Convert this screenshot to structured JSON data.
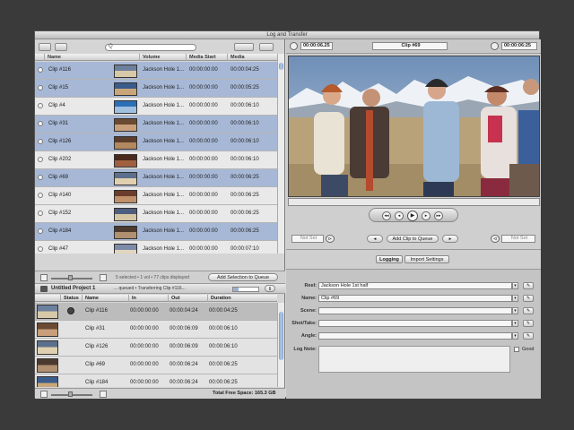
{
  "window": {
    "title": "Log and Transfer"
  },
  "browser": {
    "search_placeholder": "Q",
    "columns": [
      "Name",
      "Volume",
      "Media Start",
      "Media"
    ],
    "clips": [
      {
        "name": "Clip #116",
        "volume": "Jackson Hole 1...",
        "start": "00:00:00:00",
        "dur": "00:00:04:25",
        "selected": true
      },
      {
        "name": "Clip #15",
        "volume": "Jackson Hole 1...",
        "start": "00:00:00:00",
        "dur": "00:00:05:25",
        "selected": true
      },
      {
        "name": "Clip #4",
        "volume": "Jackson Hole 1...",
        "start": "00:00:00:00",
        "dur": "00:00:06:10",
        "selected": false
      },
      {
        "name": "Clip #31",
        "volume": "Jackson Hole 1...",
        "start": "00:00:00:00",
        "dur": "00:00:06:10",
        "selected": true
      },
      {
        "name": "Clip #126",
        "volume": "Jackson Hole 1...",
        "start": "00:00:00:00",
        "dur": "00:00:06:10",
        "selected": true
      },
      {
        "name": "Clip #202",
        "volume": "Jackson Hole 1...",
        "start": "00:00:00:00",
        "dur": "00:00:06:10",
        "selected": false
      },
      {
        "name": "Clip #69",
        "volume": "Jackson Hole 1...",
        "start": "00:00:00:00",
        "dur": "00:00:06:25",
        "selected": true
      },
      {
        "name": "Clip #140",
        "volume": "Jackson Hole 1...",
        "start": "00:00:00:00",
        "dur": "00:00:06:25",
        "selected": false
      },
      {
        "name": "Clip #152",
        "volume": "Jackson Hole 1...",
        "start": "00:00:00:00",
        "dur": "00:00:06:25",
        "selected": false
      },
      {
        "name": "Clip #184",
        "volume": "Jackson Hole 1...",
        "start": "00:00:00:00",
        "dur": "00:00:06:25",
        "selected": true
      },
      {
        "name": "Clip #47",
        "volume": "Jackson Hole 1...",
        "start": "00:00:00:00",
        "dur": "00:00:07:10",
        "selected": false
      }
    ],
    "status_text": "5 selected • 1 vol • 77 clips displayed",
    "add_selection_label": "Add Selection to Queue"
  },
  "queue": {
    "project_name": "Untitled Project 1",
    "progress_text": "... queued • Transferring Clip #116...",
    "columns": [
      "Status",
      "Name",
      "In",
      "Out",
      "Duration"
    ],
    "items": [
      {
        "name": "Clip #116",
        "in": "00:00:00:00",
        "out": "00:00:04:24",
        "dur": "00:00:04:25",
        "active": true
      },
      {
        "name": "Clip #31",
        "in": "00:00:00:00",
        "out": "00:00:06:09",
        "dur": "00:00:06:10",
        "active": false
      },
      {
        "name": "Clip #126",
        "in": "00:00:00:00",
        "out": "00:00:06:09",
        "dur": "00:00:06:10",
        "active": false
      },
      {
        "name": "Clip #69",
        "in": "00:00:00:00",
        "out": "00:00:06:24",
        "dur": "00:00:06:25",
        "active": false
      },
      {
        "name": "Clip #184",
        "in": "00:00:00:00",
        "out": "00:00:06:24",
        "dur": "00:00:06:25",
        "active": false
      }
    ],
    "free_space": "Total Free Space: 165.3 GB"
  },
  "viewer": {
    "tc_left": "00:00:06.25",
    "clip_name": "Clip #69",
    "tc_right": "00:00:06:25",
    "mark_in": "Not Set",
    "mark_out": "Not Set",
    "add_clip_label": "Add Clip to Queue",
    "tab_logging": "Logging",
    "tab_import": "Import Settings"
  },
  "logging": {
    "reel_label": "Reel:",
    "reel_value": "Jackson Hole 1st half",
    "name_label": "Name:",
    "name_value": "Clip #69",
    "scene_label": "Scene:",
    "shot_label": "Shot/Take:",
    "angle_label": "Angle:",
    "lognote_label": "Log Note:",
    "good_label": "Good"
  },
  "colors": {
    "selection": "#a7b8d6",
    "scroll_thumb": "#8ea7cc",
    "window_bg": "#d7d7d7"
  }
}
